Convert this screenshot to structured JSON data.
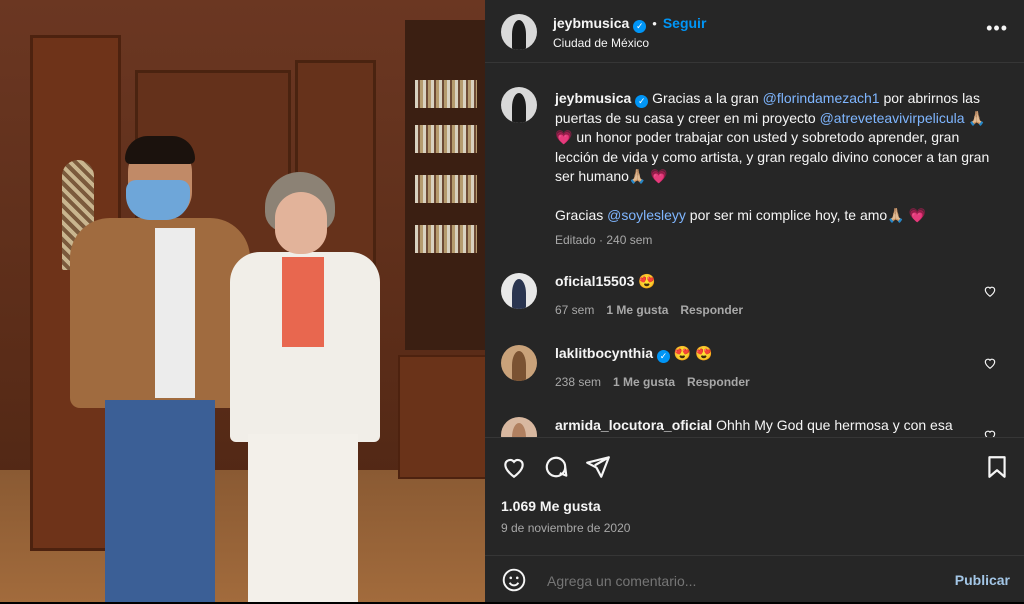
{
  "post": {
    "username": "jeybmusica",
    "follow_label": "Seguir",
    "location": "Ciudad de México",
    "more_label": "•••",
    "caption_parts": {
      "p1_a": "Gracias a la gran ",
      "m1": "@florindamezach1",
      "p1_b": " por abrirnos las puertas de su casa y creer en mi proyecto ",
      "m2": "@atreveteavivirpelicula",
      "p1_c": " 🙏🏼 💗  un honor poder trabajar con usted y sobretodo aprender, gran lección de vida y como artista, y gran regalo divino conocer a tan gran ser humano🙏🏼 💗",
      "p2_a": "Gracias ",
      "m3": "@soylesleyy",
      "p2_b": " por ser mi complice hoy, te amo🙏🏼 💗"
    },
    "caption_meta": "Editado · 240 sem",
    "likes": "1.069 Me gusta",
    "date": "9 de noviembre de 2020",
    "comment_placeholder": "Agrega un comentario...",
    "publish_label": "Publicar"
  },
  "comments": [
    {
      "user": "oficial15503",
      "text": "😍",
      "time": "67 sem",
      "likes": "1 Me gusta",
      "reply": "Responder"
    },
    {
      "user": "laklitbocynthia",
      "text": "😍 😍",
      "time": "238 sem",
      "likes": "1 Me gusta",
      "reply": "Responder"
    },
    {
      "user": "armida_locutora_oficial",
      "text": "Ohhh My God que hermosa y con esa"
    }
  ],
  "icons": [
    "verified-badge-icon",
    "more-options-icon",
    "heart-icon",
    "comment-icon",
    "share-icon",
    "save-icon",
    "emoji-icon"
  ],
  "colors": {
    "panel_bg": "#262626",
    "link": "#0095f6",
    "mention": "#7fb6ff",
    "muted": "#a8a8a8"
  }
}
